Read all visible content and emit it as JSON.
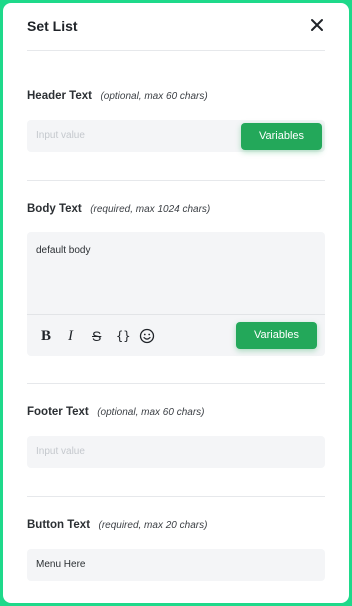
{
  "panel": {
    "title": "Set List",
    "close_icon": "close-icon"
  },
  "header_text": {
    "label": "Header Text",
    "hint": "(optional, max 60 chars)",
    "placeholder": "Input value",
    "variables_label": "Variables"
  },
  "body_text": {
    "label": "Body Text",
    "hint": "(required, max 1024 chars)",
    "value": "default body",
    "toolbar": {
      "bold": "B",
      "italic": "I",
      "strike": "S",
      "code": "{}",
      "emoji_icon": "smile-icon"
    },
    "variables_label": "Variables"
  },
  "footer_text": {
    "label": "Footer Text",
    "hint": "(optional, max 60 chars)",
    "placeholder": "Input value"
  },
  "button_text": {
    "label": "Button Text",
    "hint": "(required, max 20 chars)",
    "value": "Menu Here"
  },
  "colors": {
    "accent": "#23a85a",
    "frame": "#1ed98a",
    "field_bg": "#f4f5f7"
  }
}
